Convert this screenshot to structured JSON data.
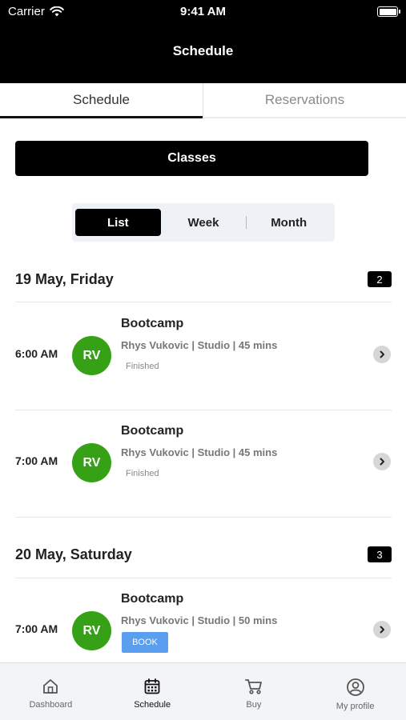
{
  "status_bar": {
    "carrier": "Carrier",
    "time": "9:41 AM"
  },
  "nav": {
    "title": "Schedule"
  },
  "tabs": [
    {
      "label": "Schedule",
      "active": true
    },
    {
      "label": "Reservations",
      "active": false
    }
  ],
  "classes_button": {
    "label": "Classes"
  },
  "view_toggle": [
    {
      "label": "List",
      "active": true
    },
    {
      "label": "Week",
      "active": false
    },
    {
      "label": "Month",
      "active": false
    }
  ],
  "days": [
    {
      "title": "19 May, Friday",
      "count": "2",
      "sessions": [
        {
          "time": "6:00 AM",
          "initials": "RV",
          "name": "Bootcamp",
          "meta": "Rhys Vukovic | Studio | 45 mins",
          "status": "Finished"
        },
        {
          "time": "7:00 AM",
          "initials": "RV",
          "name": "Bootcamp",
          "meta": "Rhys Vukovic | Studio | 45 mins",
          "status": "Finished"
        }
      ]
    },
    {
      "title": "20 May, Saturday",
      "count": "3",
      "sessions": [
        {
          "time": "7:00 AM",
          "initials": "RV",
          "name": "Bootcamp",
          "meta": "Rhys Vukovic | Studio | 50 mins",
          "action": "BOOK"
        }
      ]
    }
  ],
  "tab_bar": [
    {
      "label": "Dashboard",
      "icon": "home-icon",
      "active": false
    },
    {
      "label": "Schedule",
      "icon": "calendar-icon",
      "active": true
    },
    {
      "label": "Buy",
      "icon": "cart-icon",
      "active": false
    },
    {
      "label": "My profile",
      "icon": "profile-icon",
      "active": false
    }
  ],
  "colors": {
    "header": "#000000",
    "avatar": "#36a117",
    "book_button": "#5a9ef0",
    "tab_bar_bg": "#f3f4f6"
  }
}
